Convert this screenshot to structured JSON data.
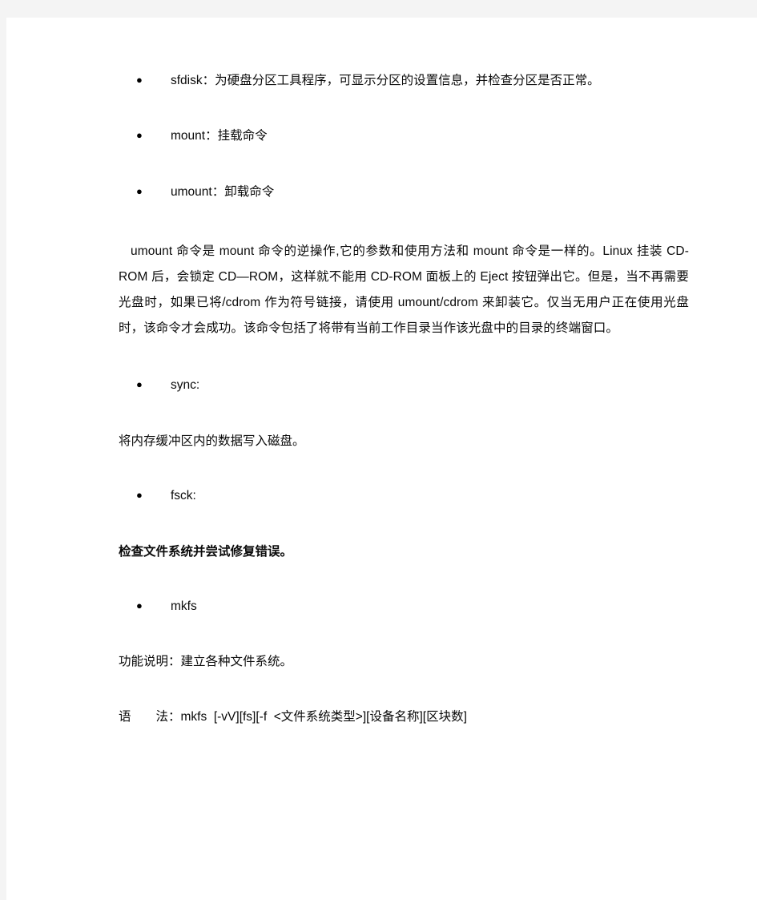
{
  "page": {
    "background_color": "#f4f4f4",
    "sheet_color": "#ffffff",
    "text_color": "#0a0a0a"
  },
  "bullet_glyph": "●",
  "blocks": [
    {
      "kind": "bullet",
      "name": "bullet-item-sfdisk",
      "text": "sfdisk：为硬盘分区工具程序，可显示分区的设置信息，并检查分区是否正常。"
    },
    {
      "kind": "bullet",
      "name": "bullet-item-mount",
      "text": "mount：挂载命令"
    },
    {
      "kind": "bullet",
      "name": "bullet-item-umount",
      "text": "umount：卸载命令"
    },
    {
      "kind": "paragraph",
      "name": "paragraph-umount-description",
      "text": "umount 命令是 mount 命令的逆操作,它的参数和使用方法和 mount 命令是一样的。Linux 挂装 CD-ROM 后，会锁定 CD—ROM，这样就不能用 CD-ROM 面板上的 Eject 按钮弹出它。但是，当不再需要光盘时，如果已将/cdrom 作为符号链接，请使用 umount/cdrom 来卸装它。仅当无用户正在使用光盘时，该命令才会成功。该命令包括了将带有当前工作目录当作该光盘中的目录的终端窗口。"
    },
    {
      "kind": "bullet",
      "name": "bullet-item-sync",
      "text": "sync:"
    },
    {
      "kind": "caption",
      "name": "caption-sync-description",
      "bold": false,
      "text": "将内存缓冲区内的数据写入磁盘。"
    },
    {
      "kind": "bullet",
      "name": "bullet-item-fsck",
      "text": "fsck:"
    },
    {
      "kind": "caption",
      "name": "caption-fsck-description",
      "bold": true,
      "text": "检查文件系统并尝试修复错误。"
    },
    {
      "kind": "bullet",
      "name": "bullet-item-mkfs",
      "text": "mkfs"
    },
    {
      "kind": "caption",
      "name": "caption-mkfs-function",
      "bold": false,
      "text": "功能说明：建立各种文件系统。"
    },
    {
      "kind": "syntax",
      "name": "syntax-mkfs-usage",
      "text": "语　　法：mkfs  [-vV][fs][-f  <文件系统类型>][设备名称][区块数]"
    }
  ]
}
